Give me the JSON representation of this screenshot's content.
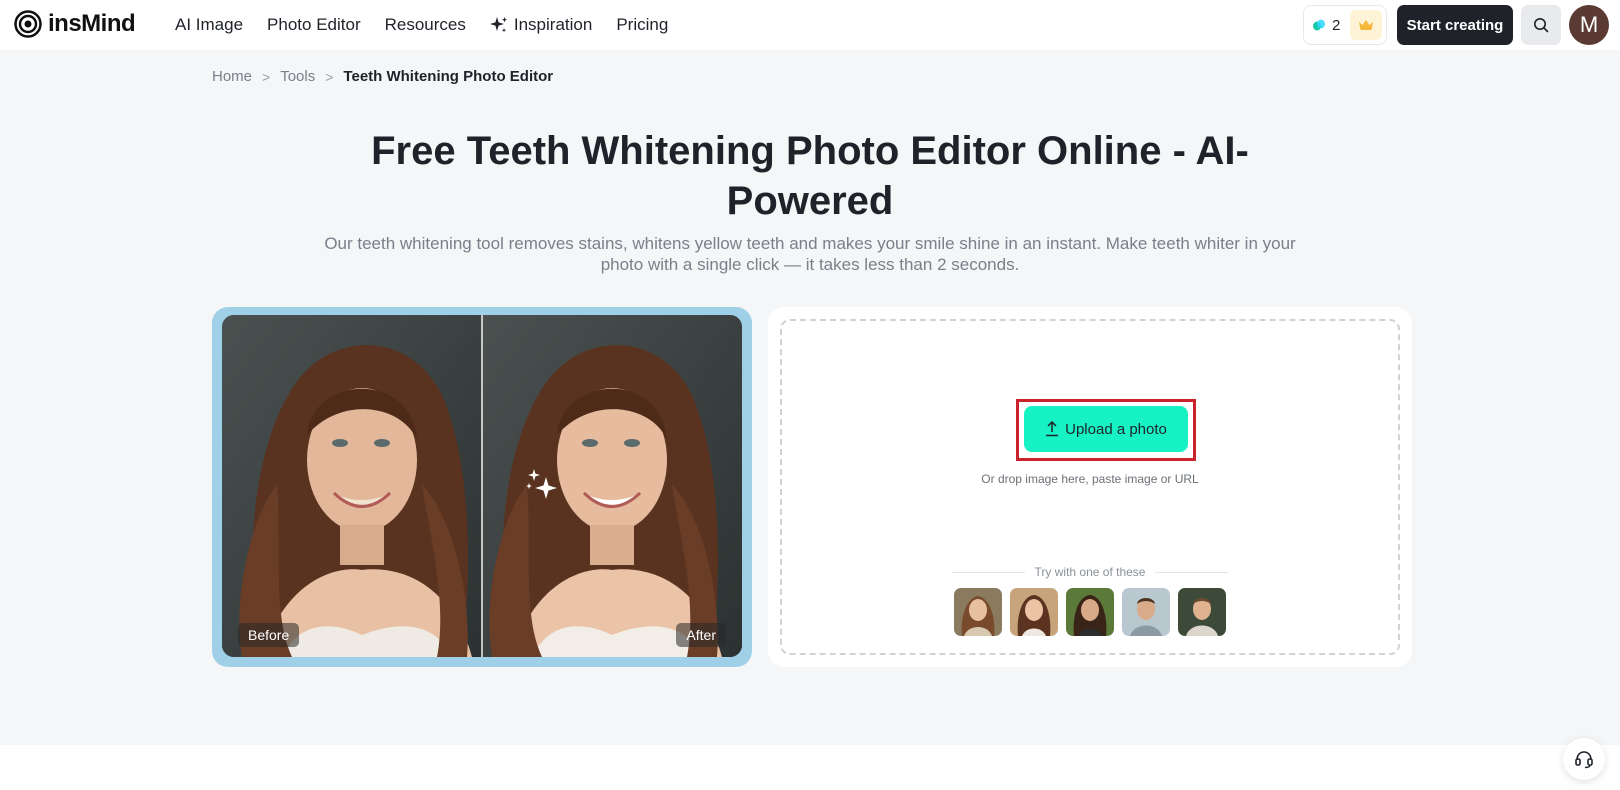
{
  "brand": {
    "name": "insMind"
  },
  "nav": {
    "items": [
      {
        "label": "AI Image"
      },
      {
        "label": "Photo Editor"
      },
      {
        "label": "Resources"
      },
      {
        "label": "Inspiration"
      },
      {
        "label": "Pricing"
      }
    ]
  },
  "header": {
    "credits": "2",
    "start_label": "Start creating",
    "avatar_letter": "M"
  },
  "breadcrumb": {
    "items": [
      {
        "label": "Home"
      },
      {
        "label": "Tools"
      },
      {
        "label": "Teeth Whitening Photo Editor"
      }
    ],
    "separator": ">"
  },
  "hero": {
    "title": "Free Teeth Whitening Photo Editor Online - AI-Powered",
    "subtitle": "Our teeth whitening tool removes stains, whitens yellow teeth and makes your smile shine in an instant. Make teeth whiter in your photo with a single click — it takes less than 2 seconds."
  },
  "compare": {
    "before_label": "Before",
    "after_label": "After"
  },
  "upload": {
    "button_label": "Upload a photo",
    "hint": "Or drop image here, paste image or URL",
    "try_label": "Try with one of these",
    "samples": [
      {
        "icon": "woman-portrait-1"
      },
      {
        "icon": "woman-portrait-2"
      },
      {
        "icon": "woman-portrait-3"
      },
      {
        "icon": "man-portrait-1"
      },
      {
        "icon": "man-portrait-2"
      }
    ]
  },
  "colors": {
    "accent": "#17f2c4",
    "primary_button": "#1f2329",
    "highlight": "#c9232b",
    "compare_frame": "#9fd0e8"
  }
}
